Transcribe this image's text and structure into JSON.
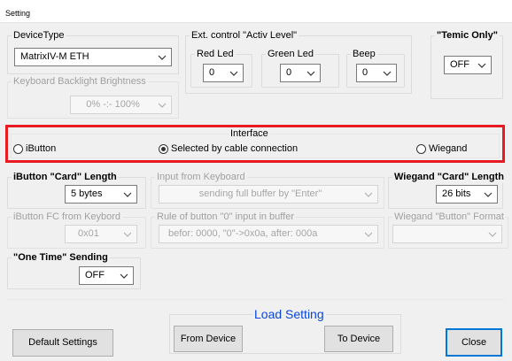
{
  "window": {
    "title": "Setting"
  },
  "device_type": {
    "label": "DeviceType",
    "value": "MatrixIV-M ETH"
  },
  "backlight": {
    "label": "Keyboard Backlight Brightness",
    "value": "0% -:- 100%"
  },
  "ext_control": {
    "label": "Ext. control  \"Activ Level\"",
    "red": {
      "label": "Red Led",
      "value": "0"
    },
    "green": {
      "label": "Green Led",
      "value": "0"
    },
    "beep": {
      "label": "Beep",
      "value": "0"
    }
  },
  "temic": {
    "label": "\"Temic Only\"",
    "value": "OFF"
  },
  "interface": {
    "label": "Interface",
    "options": [
      {
        "label": "iButton",
        "selected": false
      },
      {
        "label": "Selected by cable connection",
        "selected": true
      },
      {
        "label": "Wiegand",
        "selected": false
      }
    ],
    "highlight_color": "#e81b23"
  },
  "ibutton_length": {
    "label": "iButton \"Card\" Length",
    "value": "5 bytes"
  },
  "input_keyboard": {
    "label": "Input from Keyboard",
    "value": "sending full buffer by \"Enter\""
  },
  "wiegand_length": {
    "label": "Wiegand \"Card\" Length",
    "value": "26 bits"
  },
  "ibutton_fc": {
    "label": "iButton FC from Keybord",
    "value": "0x01"
  },
  "rule_zero": {
    "label": "Rule of button \"0\" input in buffer",
    "value": "befor: 0000, \"0\"->0x0a, after: 000a"
  },
  "wiegand_format": {
    "label": "Wiegand \"Button\" Format",
    "value": ""
  },
  "one_time": {
    "label": "\"One Time\" Sending",
    "value": "OFF"
  },
  "load_setting": {
    "label": "Load Setting",
    "from_device": "From Device",
    "to_device": "To Device",
    "label_color": "#0a46d8"
  },
  "buttons": {
    "default_settings": "Default Settings",
    "close": "Close"
  }
}
